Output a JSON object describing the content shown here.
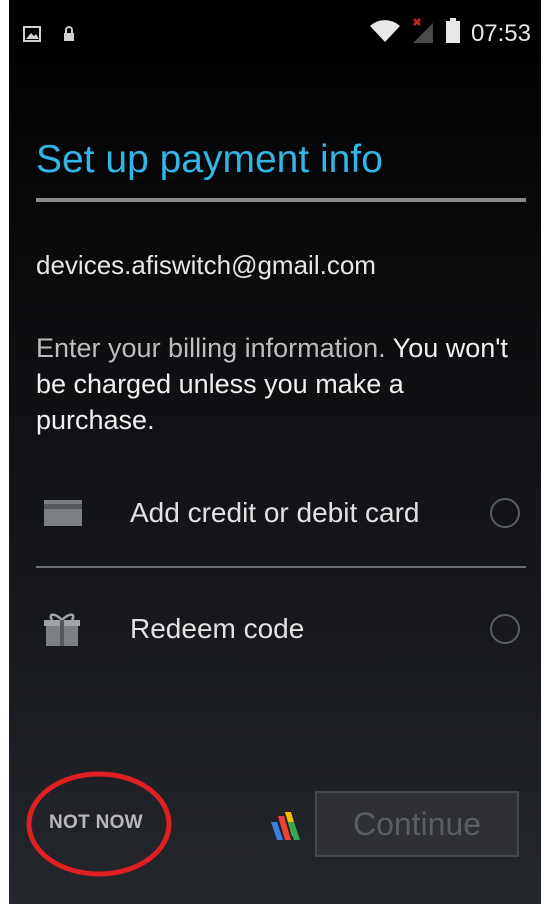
{
  "status_bar": {
    "time": "07:53",
    "icons": [
      "image-icon",
      "lock-icon",
      "wifi-icon",
      "signal-no-service-icon",
      "battery-icon"
    ]
  },
  "screen": {
    "title": "Set up payment info",
    "account_email": "devices.afiswitch@gmail.com",
    "info_light": "Enter your billing information.",
    "info_strong": " You won't be charged unless you make a purchase.",
    "options": [
      {
        "label": "Add credit or debit card",
        "icon": "credit-card-icon",
        "selected": false
      },
      {
        "label": "Redeem code",
        "icon": "gift-icon",
        "selected": false
      }
    ]
  },
  "actions": {
    "not_now_label": "NOT NOW",
    "continue_label": "Continue",
    "continue_enabled": false
  },
  "colors": {
    "accent": "#33b5e5",
    "annotation": "#e02020"
  }
}
